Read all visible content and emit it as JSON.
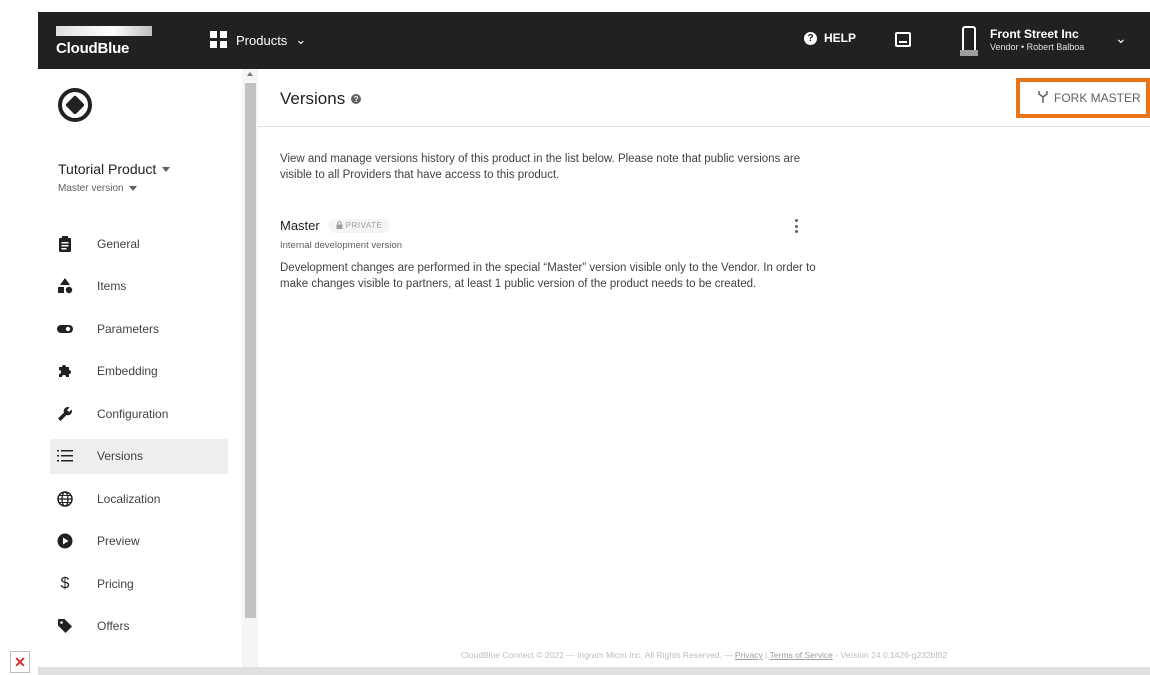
{
  "topbar": {
    "logo_text": "CloudBlue",
    "products_label": "Products",
    "help_label": "HELP",
    "account_name": "Front Street Inc",
    "account_role": "Vendor • Robert Balboa"
  },
  "sidebar": {
    "product_title": "Tutorial Product",
    "version_selector": "Master version",
    "items": [
      {
        "label": "General",
        "icon": "clipboard-icon"
      },
      {
        "label": "Items",
        "icon": "shapes-icon"
      },
      {
        "label": "Parameters",
        "icon": "toggle-icon"
      },
      {
        "label": "Embedding",
        "icon": "puzzle-icon"
      },
      {
        "label": "Configuration",
        "icon": "wrench-icon"
      },
      {
        "label": "Versions",
        "icon": "list-icon",
        "active": true
      },
      {
        "label": "Localization",
        "icon": "globe-icon"
      },
      {
        "label": "Preview",
        "icon": "play-icon"
      },
      {
        "label": "Pricing",
        "icon": "dollar-icon"
      },
      {
        "label": "Offers",
        "icon": "tag-icon"
      }
    ]
  },
  "main": {
    "title": "Versions",
    "fork_button": "FORK MASTER",
    "intro": "View and manage versions history of this product in the list below. Please note that public versions are visible to all Providers that have access to this product.",
    "version": {
      "name": "Master",
      "badge": "PRIVATE",
      "subtitle": "Internal development version",
      "description": "Development changes are performed in the special “Master” version visible only to the Vendor. In order to make changes visible to partners, at least 1 public version of the product needs to be created."
    }
  },
  "footer": {
    "copyright": "CloudBlue Connect © 2022 — Ingram Micro Inc. All Rights Reserved. — ",
    "privacy": "Privacy",
    "separator": " | ",
    "terms": "Terms of Service",
    "version": " - Version 24.0.1426-g232bf62"
  },
  "colors": {
    "topbar": "#212121",
    "highlight": "#e97317",
    "active_nav": "#eeeeee"
  }
}
